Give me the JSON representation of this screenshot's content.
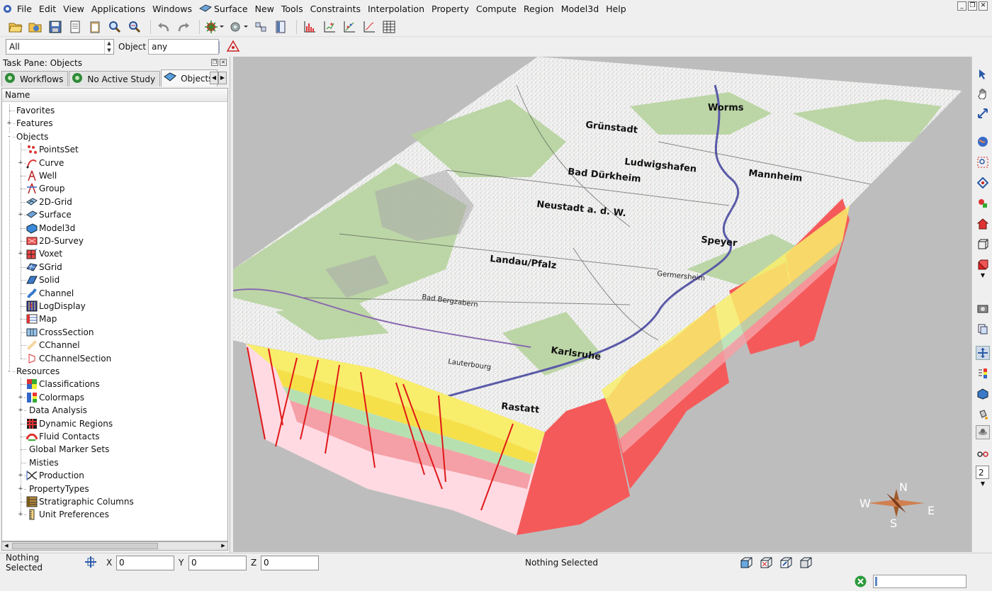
{
  "menubar": {
    "items": [
      "File",
      "Edit",
      "View",
      "Applications",
      "Windows",
      "Surface",
      "New",
      "Tools",
      "Constraints",
      "Interpolation",
      "Property",
      "Compute",
      "Region",
      "Model3d",
      "Help"
    ]
  },
  "filterbar": {
    "scope_value": "All",
    "object_label": "Object",
    "object_value": "any"
  },
  "taskpane": {
    "title": "Task Pane: Objects",
    "tabs": [
      "Workflows",
      "No Active Study",
      "Objects"
    ],
    "column_header": "Name",
    "tree": [
      {
        "label": "Favorites",
        "level": 0,
        "expand": "",
        "icon": ""
      },
      {
        "label": "Features",
        "level": 0,
        "expand": "+",
        "icon": ""
      },
      {
        "label": "Objects",
        "level": 0,
        "expand": "-",
        "icon": ""
      },
      {
        "label": "PointsSet",
        "level": 1,
        "expand": "",
        "icon": "pointsset-icon"
      },
      {
        "label": "Curve",
        "level": 1,
        "expand": "+",
        "icon": "curve-icon"
      },
      {
        "label": "Well",
        "level": 1,
        "expand": "",
        "icon": "well-icon"
      },
      {
        "label": "Group",
        "level": 1,
        "expand": "",
        "icon": "group-icon"
      },
      {
        "label": "2D-Grid",
        "level": 1,
        "expand": "",
        "icon": "grid2d-icon"
      },
      {
        "label": "Surface",
        "level": 1,
        "expand": "+",
        "icon": "surface-icon"
      },
      {
        "label": "Model3d",
        "level": 1,
        "expand": "",
        "icon": "model3d-icon"
      },
      {
        "label": "2D-Survey",
        "level": 1,
        "expand": "",
        "icon": "survey2d-icon"
      },
      {
        "label": "Voxet",
        "level": 1,
        "expand": "+",
        "icon": "voxet-icon"
      },
      {
        "label": "SGrid",
        "level": 1,
        "expand": "",
        "icon": "sgrid-icon"
      },
      {
        "label": "Solid",
        "level": 1,
        "expand": "",
        "icon": "solid-icon"
      },
      {
        "label": "Channel",
        "level": 1,
        "expand": "",
        "icon": "channel-icon"
      },
      {
        "label": "LogDisplay",
        "level": 1,
        "expand": "",
        "icon": "logdisplay-icon"
      },
      {
        "label": "Map",
        "level": 1,
        "expand": "",
        "icon": "map-icon"
      },
      {
        "label": "CrossSection",
        "level": 1,
        "expand": "",
        "icon": "crosssection-icon"
      },
      {
        "label": "CChannel",
        "level": 1,
        "expand": "",
        "icon": "cchannel-icon"
      },
      {
        "label": "CChannelSection",
        "level": 1,
        "expand": "",
        "icon": "cchannelsection-icon"
      },
      {
        "label": "Resources",
        "level": 0,
        "expand": "-",
        "icon": ""
      },
      {
        "label": "Classifications",
        "level": 1,
        "expand": "",
        "icon": "classifications-icon"
      },
      {
        "label": "Colormaps",
        "level": 1,
        "expand": "+",
        "icon": "colormaps-icon"
      },
      {
        "label": "Data Analysis",
        "level": 1,
        "expand": "+",
        "icon": ""
      },
      {
        "label": "Dynamic Regions",
        "level": 1,
        "expand": "",
        "icon": "dynamic-regions-icon"
      },
      {
        "label": "Fluid Contacts",
        "level": 1,
        "expand": "",
        "icon": "fluid-contacts-icon"
      },
      {
        "label": "Global Marker Sets",
        "level": 1,
        "expand": "",
        "icon": ""
      },
      {
        "label": "Misties",
        "level": 1,
        "expand": "",
        "icon": ""
      },
      {
        "label": "Production",
        "level": 1,
        "expand": "+",
        "icon": "production-icon"
      },
      {
        "label": "PropertyTypes",
        "level": 1,
        "expand": "+",
        "icon": ""
      },
      {
        "label": "Stratigraphic Columns",
        "level": 1,
        "expand": "",
        "icon": "strat-columns-icon"
      },
      {
        "label": "Unit Preferences",
        "level": 1,
        "expand": "+",
        "icon": "unit-prefs-icon"
      }
    ]
  },
  "viewport": {
    "map_labels": [
      "Worms",
      "Grünstadt",
      "Ludwigshafen",
      "Mannheim",
      "Bad Dürkheim",
      "Neustadt a. d. W.",
      "Speyer",
      "Landau/Pfalz",
      "Germersheim",
      "Bad Bergzabern",
      "Karlsruhe",
      "Lauterbourg",
      "Rastatt"
    ],
    "compass": {
      "n": "N",
      "s": "S",
      "e": "E",
      "w": "W"
    },
    "zoom_field_value": "2"
  },
  "statusbar": {
    "left_status": "Nothing Selected",
    "x_label": "X",
    "x_value": "0",
    "y_label": "Y",
    "y_value": "0",
    "z_label": "Z",
    "z_value": "0",
    "right_status": "Nothing Selected"
  },
  "colors": {
    "fault_red": "#ef3030",
    "section_pink": "#ffd9e2",
    "layer_yellow": "#f7ee6a",
    "map_green": "#b9d6a4"
  }
}
